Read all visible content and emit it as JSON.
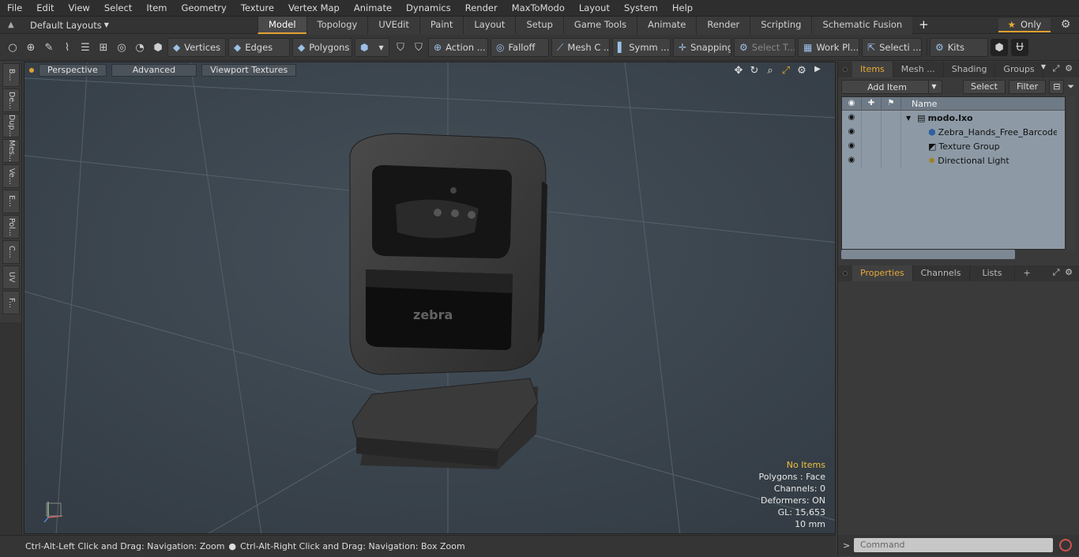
{
  "menu": [
    "File",
    "Edit",
    "View",
    "Select",
    "Item",
    "Geometry",
    "Texture",
    "Vertex Map",
    "Animate",
    "Dynamics",
    "Render",
    "MaxToModo",
    "Layout",
    "System",
    "Help"
  ],
  "layouts_label": "Default Layouts",
  "tabs": [
    "Model",
    "Topology",
    "UVEdit",
    "Paint",
    "Layout",
    "Setup",
    "Game Tools",
    "Animate",
    "Render",
    "Scripting",
    "Schematic Fusion"
  ],
  "active_tab": "Model",
  "only_label": "Only",
  "toolbar": {
    "vertices": "Vertices",
    "edges": "Edges",
    "polygons": "Polygons",
    "action": "Action ...",
    "falloff": "Falloff",
    "mesh": "Mesh C ...",
    "symm": "Symm ...",
    "snapping": "Snapping",
    "select_t": "Select T...",
    "work_pl": "Work Pl...",
    "selecti": "Selecti ...",
    "kits": "Kits"
  },
  "left_tabs": [
    "B...",
    "De...",
    "Dup...",
    "Mes...",
    "Ve...",
    "E...",
    "Pol...",
    "C...",
    "UV",
    "F..."
  ],
  "viewport": {
    "perspective": "Perspective",
    "advanced": "Advanced",
    "textures": "Viewport Textures",
    "info": {
      "no_items": "No Items",
      "polygons": "Polygons : Face",
      "channels": "Channels: 0",
      "deformers": "Deformers: ON",
      "gl": "GL: 15,653",
      "scale": "10 mm"
    }
  },
  "status": {
    "left": "Ctrl-Alt-Left Click and Drag: Navigation: Zoom",
    "right": "Ctrl-Alt-Right Click and Drag: Navigation: Box Zoom"
  },
  "items_panel": {
    "tabs": [
      "Items",
      "Mesh ...",
      "Shading",
      "Groups"
    ],
    "add_item": "Add Item",
    "select": "Select",
    "filter": "Filter",
    "col_name": "Name",
    "rows": [
      {
        "name": "modo.lxo",
        "bold": true
      },
      {
        "name": "Zebra_Hands_Free_Barcode ..."
      },
      {
        "name": "Texture Group"
      },
      {
        "name": "Directional Light"
      }
    ]
  },
  "props_panel": {
    "tabs": [
      "Properties",
      "Channels",
      "Lists"
    ]
  },
  "command_placeholder": "Command"
}
